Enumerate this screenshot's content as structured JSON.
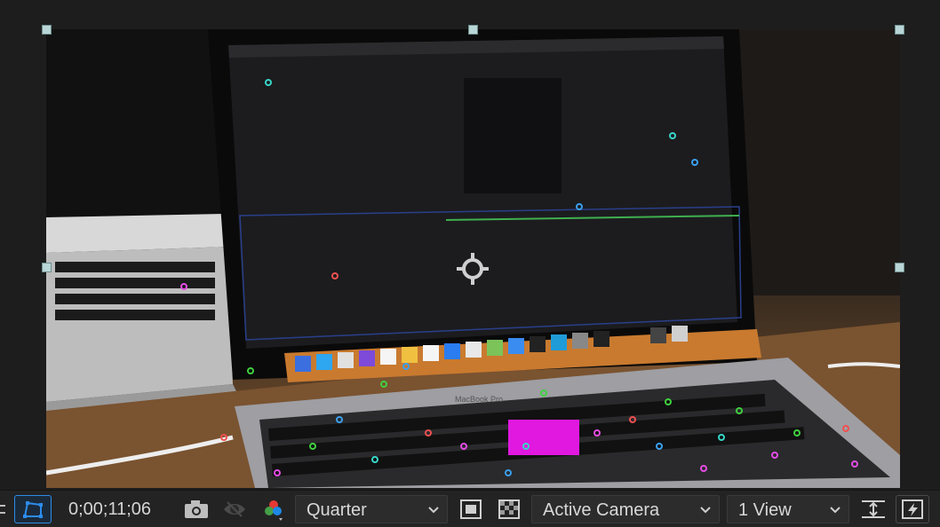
{
  "viewer": {
    "content": "Footage frame: MacBook Pro on a desk showing After Effects, with motion tracker points over the keyboard",
    "laptop_label": "MacBook Pro"
  },
  "toolbar": {
    "timecode": "0;00;11;06",
    "resolution_value": "Quarter",
    "camera_value": "Active Camera",
    "view_layout_value": "1 View"
  },
  "icons": [
    "grid-icon",
    "mask-path-icon",
    "camera-snapshot-icon",
    "show-snapshot-icon",
    "color-channels-icon",
    "chevron-down-icon",
    "region-of-interest-icon",
    "transparency-grid-icon",
    "toggle-pixel-aspect-icon",
    "fast-previews-icon"
  ],
  "colors": {
    "accent": "#2d8ceb",
    "toolbar_bg": "#232323",
    "panel_bg": "#1d1d1d",
    "handle": "#b9d6d6"
  }
}
